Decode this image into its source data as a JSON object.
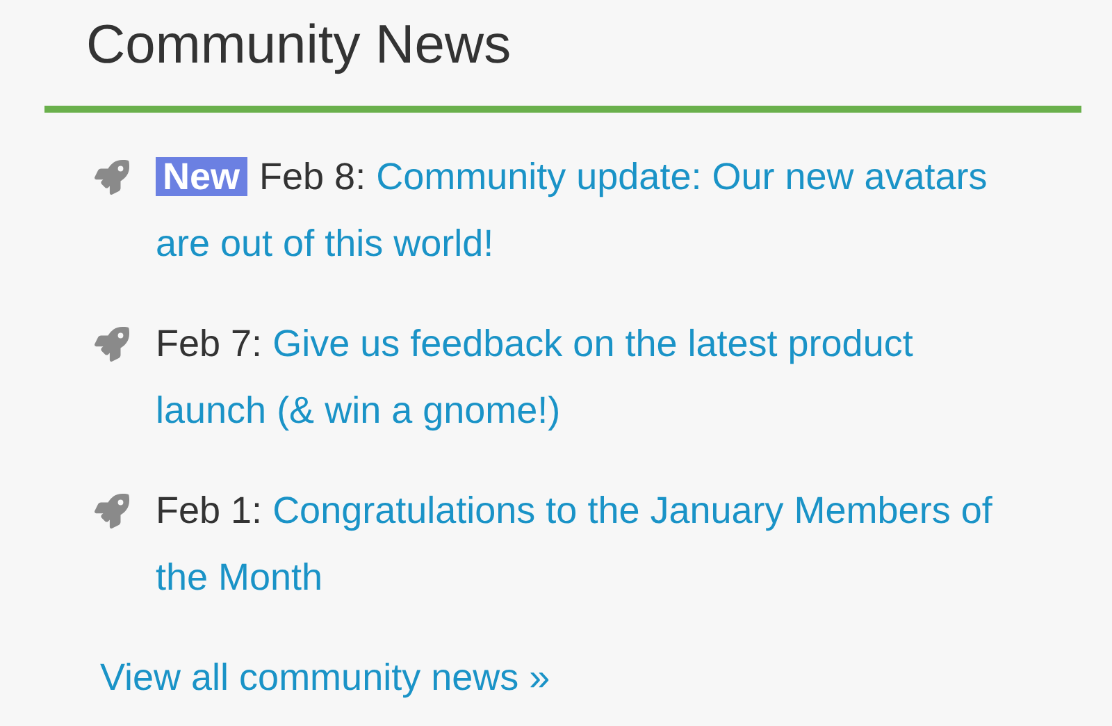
{
  "title": "Community News",
  "items": [
    {
      "badge": "New",
      "date": "Feb 8:",
      "link": "Community update: Our new avatars are out of this world!"
    },
    {
      "date": "Feb 7:",
      "link": "Give us feedback on the latest product launch (& win a gnome!)"
    },
    {
      "date": "Feb 1:",
      "link": "Congratulations to the January Members of the Month"
    }
  ],
  "footer_link": "View all community news »"
}
